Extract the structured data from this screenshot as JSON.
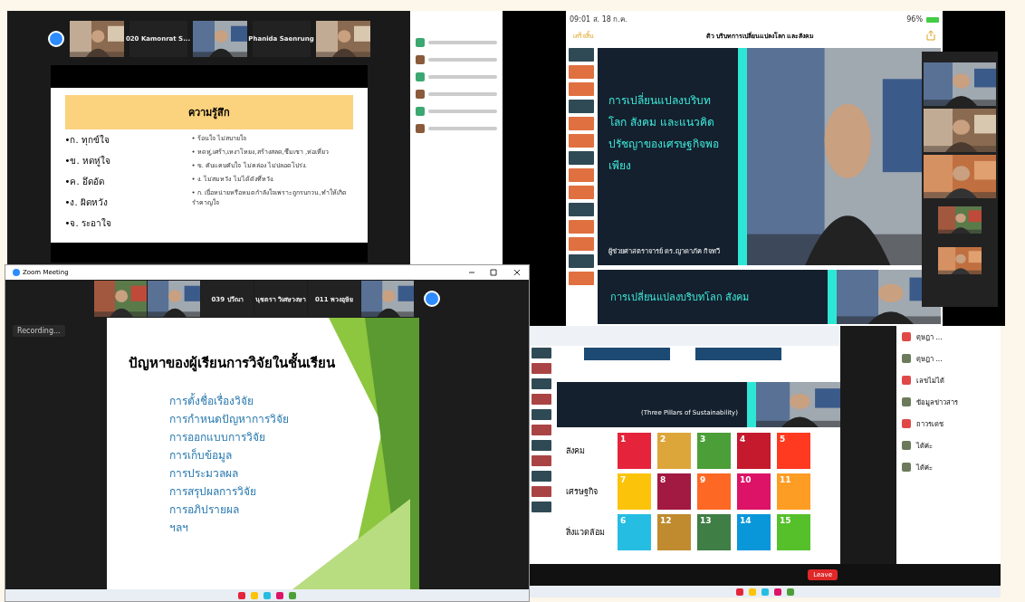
{
  "top_left_meeting": {
    "tiles": [
      {
        "kind": "picture"
      },
      {
        "kind": "name",
        "name": "020 Kamonrat S..."
      },
      {
        "kind": "picture"
      },
      {
        "kind": "name",
        "name": "Phanida Saenrung"
      },
      {
        "kind": "picture"
      }
    ],
    "slide": {
      "title": "ความรู้สึก",
      "left_items": [
        "•ก. ทุกข์ใจ",
        "•ข. หดหู่ใจ",
        "•ค. อึดอัด",
        "•ง. ผิดหวัง",
        "•จ. ระอาใจ"
      ],
      "right_items": [
        "• ร้อนใจ ไม่สบายใจ",
        "• หดหู่,เศร้า,เหงาโหยง,สร้างสลด,ซึมเซา ,ห่อเหี่ยว",
        "• ข. คับแคบคับใจ ไม่คล่อง ไม่ปลอดโปร่ง.",
        "• ง. ไม่สมหวัง ไม่ได้ดังที่หวัง.",
        "• ก. เบื่อหน่ายหรือหมดกำลังใจเพราะถูกรบกวน,ทำให้เกิดรำคาญใจ"
      ]
    }
  },
  "top_right_ipad": {
    "time": "09:01",
    "date": "ส. 18 ก.ค.",
    "battery": "96%",
    "done": "เสร็จสิ้น",
    "title": "ติว บริบทการเปลี่ยนแปลงโลก และสังคม",
    "slide_title": "การเปลี่ยนแปลงบริบทโลก สังคม และแนวคิดปรัชญาของเศรษฐกิจพอเพียง",
    "author": "ผู้ช่วยศาสตราจารย์ ดร.ญาดาภัค กิจทวี",
    "next_slide_title": "การเปลี่ยนแปลงบริบทโลก สังคม"
  },
  "bottom_left_meeting": {
    "title": "Zoom Meeting",
    "tiles": [
      {
        "kind": "picture"
      },
      {
        "kind": "picture"
      },
      {
        "kind": "name",
        "name": "039 ปวีณา"
      },
      {
        "kind": "name",
        "name": "นุชตรา วิเศษวงษา"
      },
      {
        "kind": "name",
        "name": "011 พวงอุษัย"
      },
      {
        "kind": "picture"
      }
    ],
    "recording": "Recording...",
    "slide_title": "ปัญหาของผู้เรียนการวิจัยในชั้นเรียน",
    "items": [
      "การตั้งชื่อเรื่องวิจัย",
      "การกำหนดปัญหาการวิจัย",
      "การออกแบบการวิจัย",
      "การเก็บข้อมูล",
      "การประมวลผล",
      "การสรุปผลการวิจัย",
      "การอภิปรายผล",
      "ฯลฯ"
    ]
  },
  "bottom_right_meeting": {
    "banner": "(Three Pillars of Sustainability)",
    "rows": [
      {
        "label": "สังคม",
        "goals": [
          {
            "number": "1",
            "color": "#e5243b"
          },
          {
            "number": "2",
            "color": "#dda63a"
          },
          {
            "number": "3",
            "color": "#4c9f38"
          },
          {
            "number": "4",
            "color": "#c5192d"
          },
          {
            "number": "5",
            "color": "#ff3a21"
          }
        ]
      },
      {
        "label": "เศรษฐกิจ",
        "goals": [
          {
            "number": "7",
            "color": "#fcc30b"
          },
          {
            "number": "8",
            "color": "#a21942"
          },
          {
            "number": "9",
            "color": "#fd6925"
          },
          {
            "number": "10",
            "color": "#dd1367"
          },
          {
            "number": "11",
            "color": "#fd9d24"
          }
        ]
      },
      {
        "label": "สิ่งแวดล้อม",
        "goals": [
          {
            "number": "6",
            "color": "#26bde2"
          },
          {
            "number": "12",
            "color": "#bf8b2e"
          },
          {
            "number": "13",
            "color": "#3f7e44"
          },
          {
            "number": "14",
            "color": "#0a97d9"
          },
          {
            "number": "15",
            "color": "#56c02b"
          }
        ]
      }
    ],
    "chat": [
      {
        "message": "ดุษฎา ...",
        "color": "#e04848"
      },
      {
        "message": "ดุษฎา ...",
        "color": "#6b7a5a"
      },
      {
        "message": "เลขไม่ได้",
        "color": "#e04848"
      },
      {
        "message": "ข้อมูลข่าวสาร",
        "color": "#6b7a5a"
      },
      {
        "message": "ถาวรเดช",
        "color": "#e04848"
      },
      {
        "message": "ได้ค่ะ",
        "color": "#6b7a5a"
      },
      {
        "message": "ได้ค่ะ",
        "color": "#6b7a5a"
      }
    ],
    "leave": "Leave"
  }
}
